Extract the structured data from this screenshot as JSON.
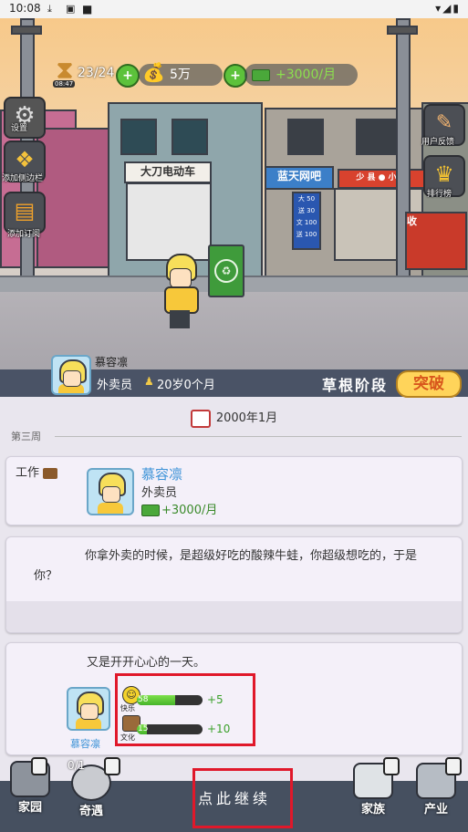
{
  "status_bar": {
    "time": "10:08",
    "download_icon": "download-icon",
    "app_icon": "notification-icon"
  },
  "hud": {
    "timer_sub": "08:47",
    "energy": "23/24",
    "money": "5万",
    "income": "+3000/月"
  },
  "side_buttons": {
    "settings": "设置",
    "add_sidebar": "添加侧边栏",
    "add_subscription": "添加订阅",
    "feedback": "用户反馈",
    "ranking": "排行榜"
  },
  "scene_signs": {
    "shop1": "大刀电动车",
    "shop2": "蓝天网吧",
    "shop3": "少 县 ● 小 ●",
    "board": [
      "大 50",
      "送 30",
      "文 100",
      "送 100"
    ],
    "cart": "收"
  },
  "character": {
    "name": "慕容凛",
    "job": "外卖员",
    "age": "20岁0个月",
    "stage": "草根阶段",
    "breakthrough": "突破"
  },
  "log": {
    "date": "2000年1月",
    "section": "第三周",
    "work_label": "工作",
    "work_name": "慕容凛",
    "work_job": "外卖员",
    "work_income": "+3000/月",
    "event_text": "你拿外卖的时候，是超级好吃的酸辣牛蛙，你超级想吃的，于是你？",
    "result_text": "又是开开心心的一天。",
    "result_name": "慕容凛",
    "stats": [
      {
        "icon": "happy-face-icon",
        "label": "快乐",
        "value": "58",
        "fill": 0.58,
        "delta": "+5"
      },
      {
        "icon": "wisdom-icon",
        "label": "文化",
        "value": "15",
        "fill": 0.15,
        "delta": "+10"
      }
    ]
  },
  "bottom": {
    "home": "家园",
    "luck": "奇遇",
    "luck_count": "0/1",
    "continue": "点此继续",
    "clan": "家族",
    "industry": "产业"
  }
}
